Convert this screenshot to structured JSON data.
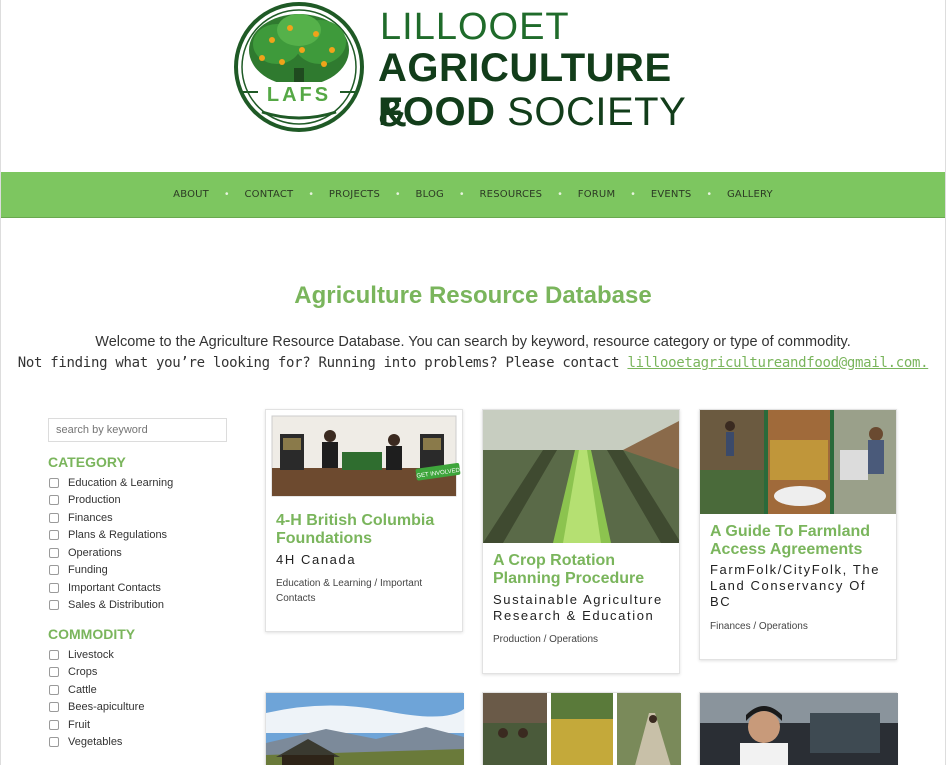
{
  "logo": {
    "line1": "LILLOOET",
    "line2": "AGRICULTURE &",
    "line3_bold": "FOOD",
    "line3_light": "SOCIETY",
    "seal_text": "LAFS"
  },
  "nav": [
    "ABOUT",
    "CONTACT",
    "PROJECTS",
    "BLOG",
    "RESOURCES",
    "FORUM",
    "EVENTS",
    "GALLERY"
  ],
  "page": {
    "title": "Agriculture Resource Database",
    "intro_line1": "Welcome to the Agriculture Resource Database. You can search by keyword, resource category or type of commodity.",
    "intro_line2": "Not finding what you’re looking for? Running into problems? Please contact",
    "email": "lillooetagricultureandfood@gmail.com."
  },
  "sidebar": {
    "search_placeholder": "search by keyword",
    "category_title": "CATEGORY",
    "categories": [
      "Education & Learning",
      "Production",
      "Finances",
      "Plans & Regulations",
      "Operations",
      "Funding",
      "Important Contacts",
      "Sales & Distribution"
    ],
    "commodity_title": "COMMODITY",
    "commodities": [
      "Livestock",
      "Crops",
      "Cattle",
      "Bees-apiculture",
      "Fruit",
      "Vegetables"
    ]
  },
  "cards": [
    {
      "title": "4-H British Columbia Foundations",
      "source": "4H Canada",
      "categories": "Education & Learning / Important Contacts",
      "badge": "GET INVOLVED"
    },
    {
      "title": "A Crop Rotation Planning Procedure",
      "source": "Sustainable Agriculture Research & Education",
      "categories": "Production / Operations"
    },
    {
      "title": "A Guide To Farmland Access Agreements",
      "source": "FarmFolk/CityFolk, The Land Conservancy Of BC",
      "categories": "Finances / Operations"
    }
  ]
}
